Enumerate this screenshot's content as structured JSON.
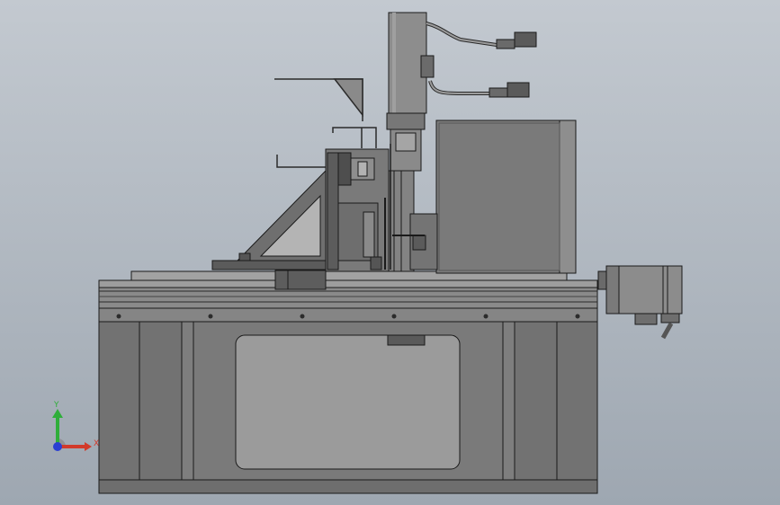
{
  "viewport": {
    "background_top": "#c3c9d0",
    "background_bottom": "#9ea7b1"
  },
  "model": {
    "body_color": "#7b7b7b",
    "dark_color": "#2b2b2b",
    "light_color": "#9a9a9a",
    "edge_color": "#1a1a1a"
  },
  "triad": {
    "y_label": "Y",
    "x_label": "X",
    "y_color": "#2fae3a",
    "x_color": "#d23a2a",
    "z_color": "#2a3fd2"
  }
}
